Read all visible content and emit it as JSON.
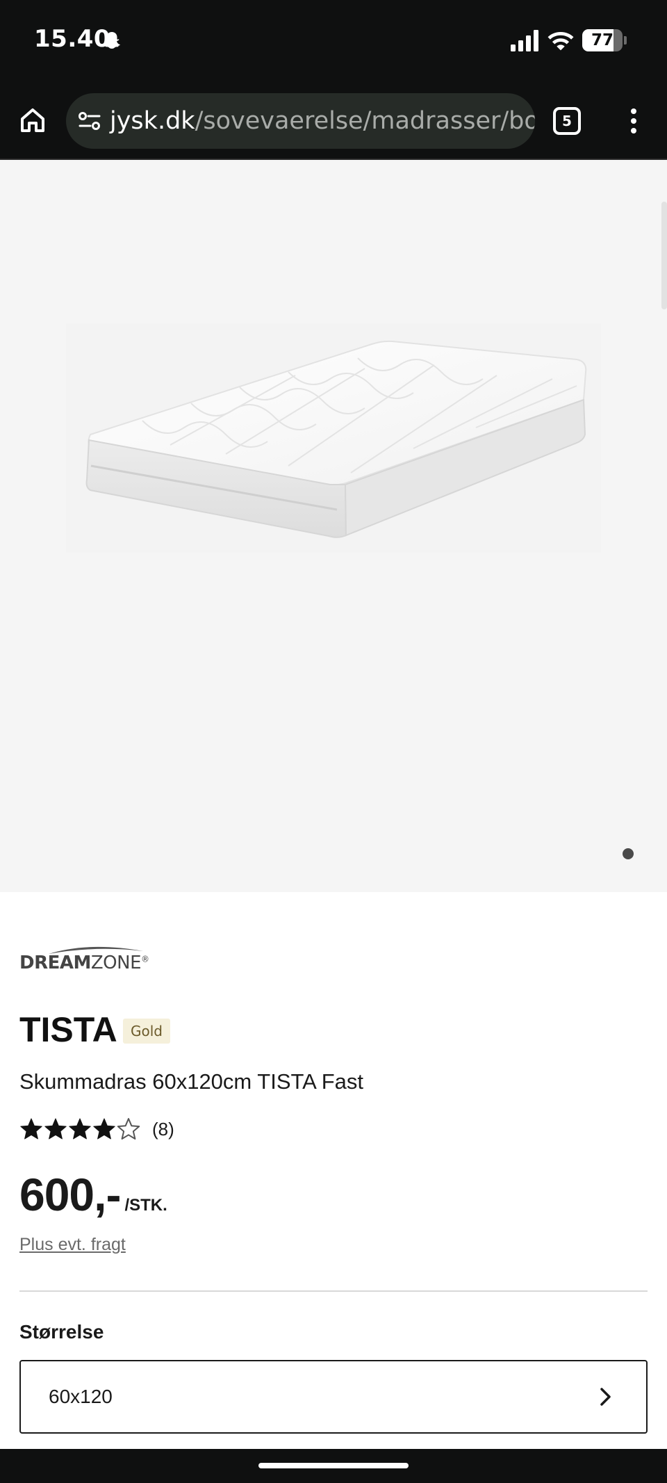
{
  "status_bar": {
    "time": "15.40",
    "battery": "77",
    "battery_level": 0.77,
    "icons": [
      "snapchat-icon",
      "signal-icon",
      "wifi-icon",
      "battery-icon"
    ]
  },
  "browser": {
    "url_domain": "jysk.dk",
    "url_path": "/sovevaerelse/madrasser/borne",
    "tab_count": "5",
    "icons": [
      "home-icon",
      "site-settings-icon",
      "tabs-icon",
      "more-menu-icon"
    ]
  },
  "gallery": {
    "image_alt": "TISTA mattress",
    "page_indicator_count": 1
  },
  "product": {
    "brand_part1": "DREAM",
    "brand_part2": "ZONE",
    "brand_mark": "®",
    "title": "TISTA",
    "badge": "Gold",
    "subtitle": "Skummadras 60x120cm TISTA Fast",
    "rating": 4,
    "rating_max": 5,
    "review_count": "(8)",
    "price": "600,-",
    "price_unit": "/STK.",
    "shipping_link": "Plus evt. fragt"
  },
  "size_section": {
    "label": "Størrelse",
    "selected": "60x120"
  },
  "colors": {
    "system_bar": "#0f1010",
    "url_pill": "#262b27",
    "gallery_bg": "#f5f5f5",
    "badge_bg": "#f5f0db",
    "badge_text": "#6b5a2a"
  }
}
